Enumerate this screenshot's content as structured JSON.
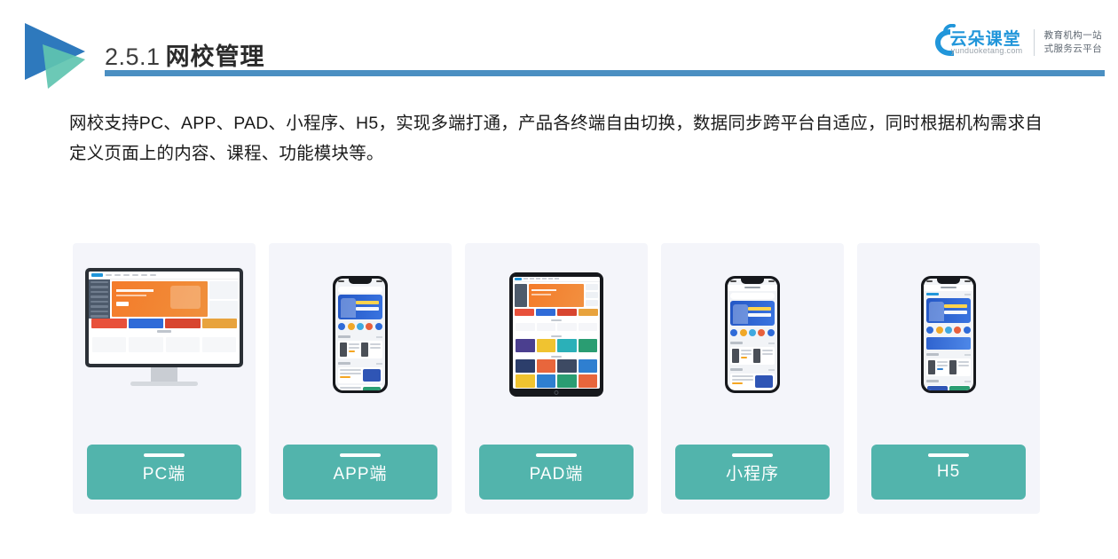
{
  "header": {
    "title_number": "2.5.1",
    "title_text": "网校管理",
    "rule_color": "#4b8fc2",
    "logo_blue": "#2e79bd",
    "logo_teal": "#5fc4b0"
  },
  "brand": {
    "name": "云朵课堂",
    "domain": "yunduoketang.com",
    "tagline_line1": "教育机构一站",
    "tagline_line2": "式服务云平台",
    "color": "#2196da"
  },
  "body": {
    "paragraph": "网校支持PC、APP、PAD、小程序、H5，实现多端打通，产品各终端自由切换，数据同步跨平台自适应，同时根据机构需求自定义页面上的内容、课程、功能模块等。"
  },
  "cards": [
    {
      "label": "PC端",
      "device": "desktop"
    },
    {
      "label": "APP端",
      "device": "phone"
    },
    {
      "label": "PAD端",
      "device": "tablet"
    },
    {
      "label": "小程序",
      "device": "phone"
    },
    {
      "label": "H5",
      "device": "phone"
    }
  ],
  "colors": {
    "label_teal": "#52b4ac",
    "card_bg": "#f4f5fa",
    "page_bg": "#ffffff",
    "text_dark": "#1a1a1a"
  }
}
